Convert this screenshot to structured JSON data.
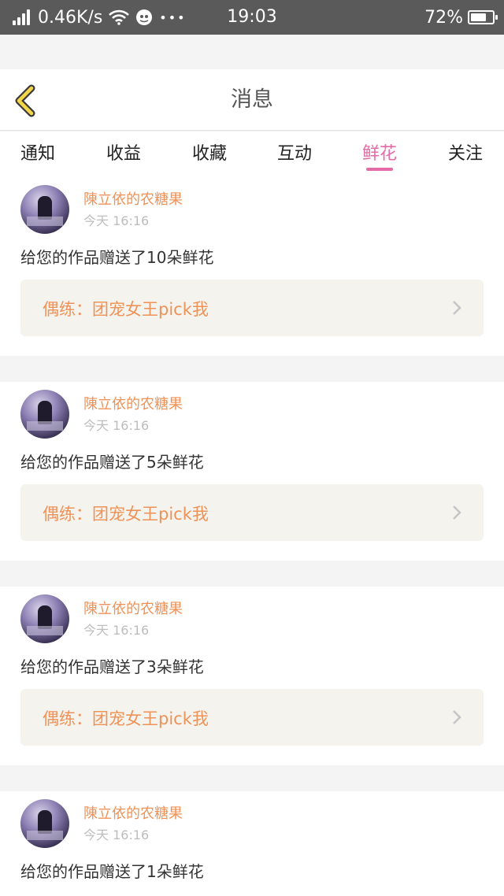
{
  "status_bar": {
    "speed": "0.46K/s",
    "dots": "•••",
    "time": "19:03",
    "battery": "72%",
    "battery_level": 0.72
  },
  "header": {
    "title": "消息"
  },
  "tabs": [
    {
      "label": "通知",
      "active": false
    },
    {
      "label": "收益",
      "active": false
    },
    {
      "label": "收藏",
      "active": false
    },
    {
      "label": "互动",
      "active": false
    },
    {
      "label": "鲜花",
      "active": true
    },
    {
      "label": "关注",
      "active": false
    }
  ],
  "colors": {
    "accent": "#e46ba8",
    "username": "#ef9257",
    "status_bar": "#5a5a5a"
  },
  "messages": [
    {
      "user": "陳立依的农糖果",
      "time": "今天 16:16",
      "text": "给您的作品赠送了10朵鲜花",
      "work": "偶练：团宠女王pick我"
    },
    {
      "user": "陳立依的农糖果",
      "time": "今天 16:16",
      "text": "给您的作品赠送了5朵鲜花",
      "work": "偶练：团宠女王pick我"
    },
    {
      "user": "陳立依的农糖果",
      "time": "今天 16:16",
      "text": "给您的作品赠送了3朵鲜花",
      "work": "偶练：团宠女王pick我"
    },
    {
      "user": "陳立依的农糖果",
      "time": "今天 16:16",
      "text": "给您的作品赠送了1朵鲜花",
      "work": ""
    }
  ]
}
